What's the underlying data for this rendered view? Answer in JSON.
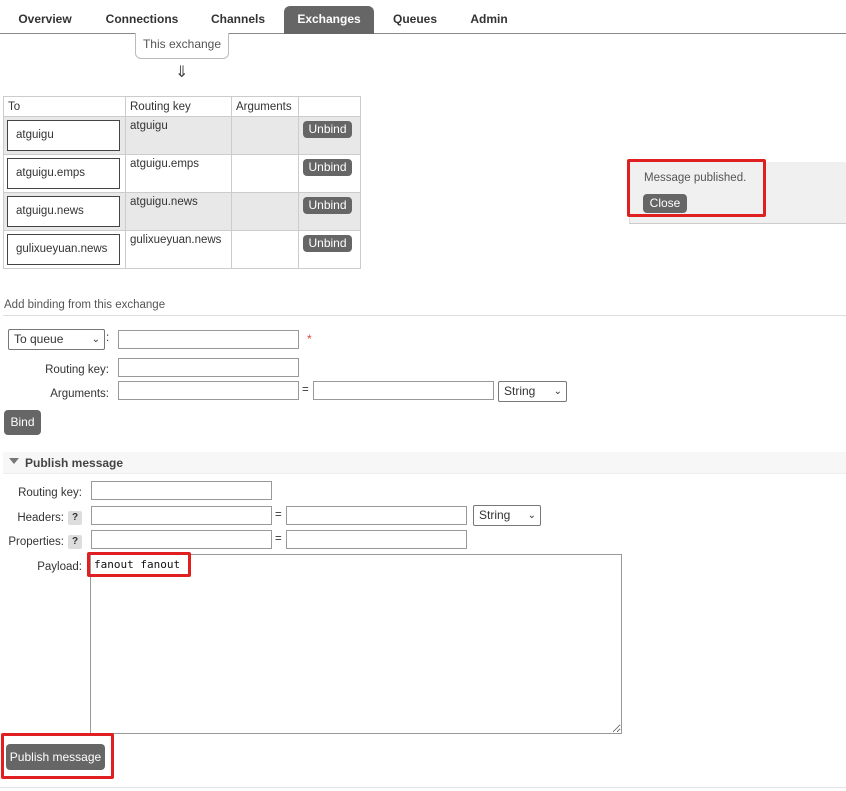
{
  "nav": {
    "tabs": [
      {
        "label": "Overview"
      },
      {
        "label": "Connections"
      },
      {
        "label": "Channels"
      },
      {
        "label": "Exchanges"
      },
      {
        "label": "Queues"
      },
      {
        "label": "Admin"
      }
    ],
    "active": "Exchanges"
  },
  "exchange": {
    "this_label": "This exchange",
    "arrow": "⇓"
  },
  "bindings": {
    "headers": [
      "To",
      "Routing key",
      "Arguments",
      ""
    ],
    "rows": [
      {
        "to": "atguigu",
        "routing_key": "atguigu",
        "arguments": "",
        "action": "Unbind"
      },
      {
        "to": "atguigu.emps",
        "routing_key": "atguigu.emps",
        "arguments": "",
        "action": "Unbind"
      },
      {
        "to": "atguigu.news",
        "routing_key": "atguigu.news",
        "arguments": "",
        "action": "Unbind"
      },
      {
        "to": "gulixueyuan.news",
        "routing_key": "gulixueyuan.news",
        "arguments": "",
        "action": "Unbind"
      }
    ]
  },
  "popup": {
    "message": "Message published.",
    "close_label": "Close"
  },
  "add_binding": {
    "title": "Add binding from this exchange",
    "destination_type": "To queue",
    "colon": ":",
    "required_mark": "*",
    "routing_key_label": "Routing key:",
    "arguments_label": "Arguments:",
    "equals": "=",
    "arg_type": "String",
    "bind_label": "Bind"
  },
  "publish": {
    "title": "Publish message",
    "routing_key_label": "Routing key:",
    "headers_label": "Headers:",
    "properties_label": "Properties:",
    "help_mark": "?",
    "equals": "=",
    "header_type": "String",
    "payload_label": "Payload:",
    "payload_value": "fanout fanout",
    "publish_label": "Publish message"
  },
  "colors": {
    "accent": "#666666",
    "highlight": "#e02020",
    "row_alt": "#e8e8e8"
  },
  "icons": {
    "dropdown": "chevron-down-icon",
    "collapse": "triangle-down-icon",
    "help": "help-icon"
  }
}
